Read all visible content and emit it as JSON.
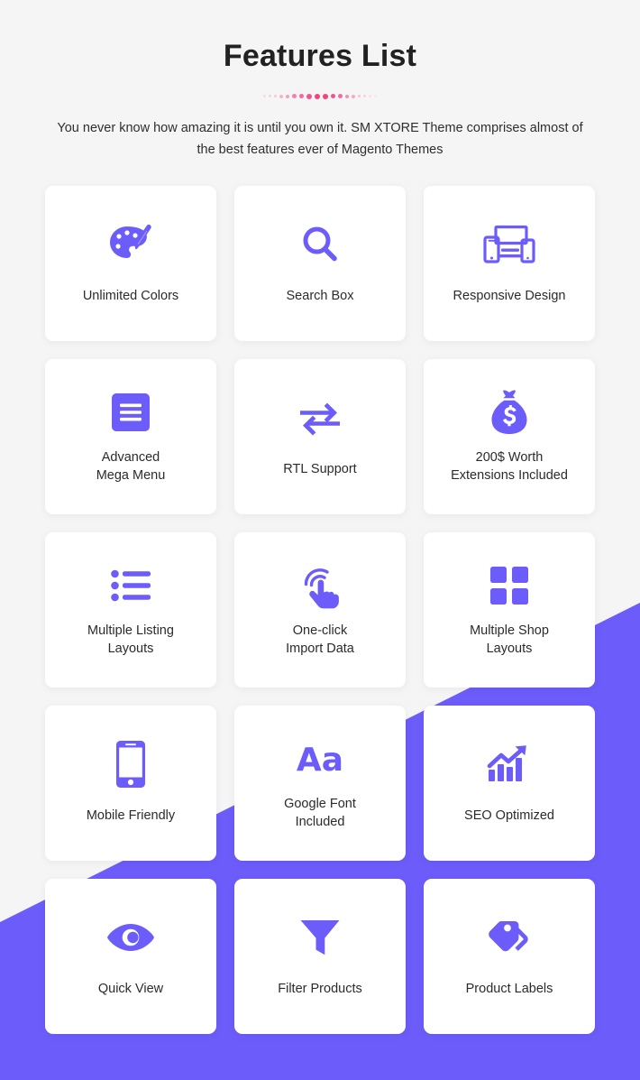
{
  "header": {
    "title": "Features List",
    "subtitle": "You never know how amazing it is until you own it. SM XTORE Theme comprises almost of the best features ever of Magento Themes"
  },
  "theme": {
    "background": "#f5f5f5",
    "card_background": "#ffffff",
    "accent_purple": "#6c5cfa",
    "divider_pink": "#f0457f",
    "title_color": "#222222",
    "text_color": "#2b2b2b"
  },
  "divider": {
    "dots": [
      {
        "size": 3,
        "color": "#fbd9e5"
      },
      {
        "size": 3,
        "color": "#fbcfdf"
      },
      {
        "size": 3,
        "color": "#fac4d8"
      },
      {
        "size": 4,
        "color": "#f8b1cb"
      },
      {
        "size": 4,
        "color": "#f79cbe"
      },
      {
        "size": 5,
        "color": "#f57fac"
      },
      {
        "size": 5,
        "color": "#f4699e"
      },
      {
        "size": 6,
        "color": "#f2528f"
      },
      {
        "size": 6,
        "color": "#f0457f"
      },
      {
        "size": 6,
        "color": "#f0457f"
      },
      {
        "size": 5,
        "color": "#f2528f"
      },
      {
        "size": 5,
        "color": "#f4699e"
      },
      {
        "size": 4,
        "color": "#f68fb6"
      },
      {
        "size": 4,
        "color": "#f8a8c6"
      },
      {
        "size": 3,
        "color": "#fac0d5"
      },
      {
        "size": 3,
        "color": "#fbcfdf"
      },
      {
        "size": 3,
        "color": "#fcdce7"
      },
      {
        "size": 3,
        "color": "#fde6ee"
      }
    ]
  },
  "features": [
    {
      "icon": "palette-icon",
      "label": "Unlimited Colors",
      "lines": 1
    },
    {
      "icon": "search-icon",
      "label": "Search Box",
      "lines": 1
    },
    {
      "icon": "responsive-devices-icon",
      "label": "Responsive Design",
      "lines": 1
    },
    {
      "icon": "mega-menu-icon",
      "label": "Advanced\nMega Menu",
      "lines": 2
    },
    {
      "icon": "rtl-arrows-icon",
      "label": "RTL Support",
      "lines": 1
    },
    {
      "icon": "money-bag-icon",
      "label": "200$ Worth\nExtensions Included",
      "lines": 2
    },
    {
      "icon": "bullet-list-icon",
      "label": "Multiple Listing\nLayouts",
      "lines": 2
    },
    {
      "icon": "tap-hand-icon",
      "label": "One-click\nImport Data",
      "lines": 2
    },
    {
      "icon": "grid-squares-icon",
      "label": "Multiple Shop\nLayouts",
      "lines": 2
    },
    {
      "icon": "smartphone-icon",
      "label": "Mobile Friendly",
      "lines": 1
    },
    {
      "icon": "font-aa-icon",
      "label": "Google Font\nIncluded",
      "lines": 2
    },
    {
      "icon": "growth-chart-icon",
      "label": "SEO Optimized",
      "lines": 1
    },
    {
      "icon": "eye-icon",
      "label": "Quick View",
      "lines": 1
    },
    {
      "icon": "funnel-icon",
      "label": "Filter Products",
      "lines": 1
    },
    {
      "icon": "tags-icon",
      "label": "Product Labels",
      "lines": 1
    }
  ]
}
